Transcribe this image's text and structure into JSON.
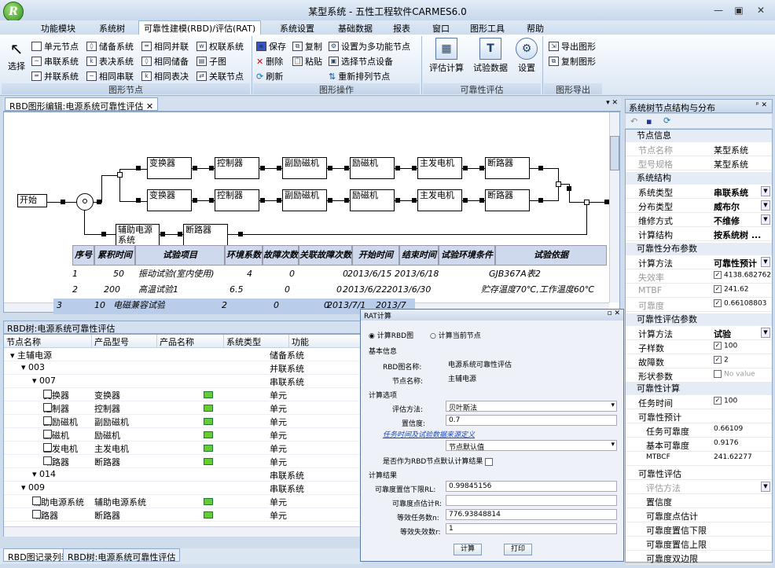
{
  "app": {
    "title": "某型系统 - 五性工程软件CARMES6.0",
    "logo": "R",
    "win_buttons": [
      "—",
      "▣",
      "✕"
    ]
  },
  "menus": [
    "功能模块",
    "系统树",
    "可靠性建模(RBD)/评估(RAT)",
    "系统设置",
    "基础数据",
    "报表",
    "窗口",
    "图形工具",
    "帮助"
  ],
  "ribbon": {
    "select_label": "选择",
    "node_group": {
      "items": [
        "单元节点",
        "串联系统",
        "并联系统",
        "储备系统",
        "表决系统",
        "相同串联",
        "相同并联",
        "相同储备",
        "相同表决",
        "权联系统",
        "子图",
        "关联节点"
      ],
      "label": "图形节点"
    },
    "op_group": {
      "items": [
        "保存",
        "删除",
        "刷新",
        "复制",
        "粘贴",
        "设置为多功能节点",
        "选择节点设备",
        "重新排列节点"
      ],
      "label": "图形操作"
    },
    "eval_group": {
      "items": [
        "评估计算",
        "试验数据",
        "设置"
      ],
      "label": "可靠性评估"
    },
    "export_group": {
      "items": [
        "导出图形",
        "复制图形"
      ],
      "label": "图形导出"
    }
  },
  "doc_tab": "RBD图形编辑:电源系统可靠性评估",
  "rbd": {
    "start": "开始",
    "row1": [
      "变换器",
      "控制器",
      "副励磁机",
      "励磁机",
      "主发电机",
      "断路器"
    ],
    "row2": [
      "变换器",
      "控制器",
      "副励磁机",
      "励磁机",
      "主发电机",
      "断路器"
    ],
    "aux": [
      "辅助电源系统",
      "断路器"
    ]
  },
  "test_table": {
    "headers": [
      "序号",
      "累积时间",
      "试验项目",
      "环境系数",
      "故障次数",
      "关联故障次数",
      "开始时间",
      "结束时间",
      "试验环境条件",
      "试验依据"
    ],
    "rows": [
      [
        "1",
        "50",
        "振动试验(室内使用)",
        "4",
        "0",
        "0",
        "2013/6/15",
        "2013/6/18",
        "",
        "GJB367A表2"
      ],
      [
        "2",
        "200",
        "高温试验1",
        "6.5",
        "0",
        "0",
        "2013/6/22",
        "2013/6/30",
        "",
        "贮存温度70℃,工作温度60℃"
      ],
      [
        "3",
        "10",
        "电磁兼容试验",
        "2",
        "0",
        "0",
        "2013/7/1",
        "2013/7",
        "",
        ""
      ]
    ]
  },
  "tree_panel": {
    "title": "RBD树:电源系统可靠性评估",
    "headers": [
      "节点名称",
      "产品型号",
      "产品名称",
      "系统类型",
      "功能"
    ],
    "rows": [
      {
        "name": "主辅电源",
        "model": "",
        "type": "储备系统",
        "level": 0
      },
      {
        "name": "003",
        "model": "",
        "type": "并联系统",
        "level": 1
      },
      {
        "name": "007",
        "model": "",
        "type": "串联系统",
        "level": 2
      },
      {
        "name": "变换器",
        "model": "变换器",
        "type": "单元",
        "level": 3
      },
      {
        "name": "控制器",
        "model": "控制器",
        "type": "单元",
        "level": 3
      },
      {
        "name": "副励磁机",
        "model": "副励磁机",
        "type": "单元",
        "level": 3
      },
      {
        "name": "励磁机",
        "model": "励磁机",
        "type": "单元",
        "level": 3
      },
      {
        "name": "主发电机",
        "model": "主发电机",
        "type": "单元",
        "level": 3
      },
      {
        "name": "断路器",
        "model": "断路器",
        "type": "单元",
        "level": 3
      },
      {
        "name": "014",
        "model": "",
        "type": "串联系统",
        "level": 2
      },
      {
        "name": "009",
        "model": "",
        "type": "串联系统",
        "level": 1
      },
      {
        "name": "辅助电源系统",
        "model": "辅助电源系统",
        "type": "单元",
        "level": 2
      },
      {
        "name": "断路器",
        "model": "断路器",
        "type": "单元",
        "level": 2
      }
    ]
  },
  "bottom_tabs": [
    "RBD图记录列表",
    "RBD树:电源系统可靠性评估"
  ],
  "right_panel": {
    "title": "系统树节点结构与分布",
    "node_info": "节点信息",
    "node_name_k": "节点名称",
    "node_name_v": "某型系统",
    "model_k": "型号规格",
    "model_v": "某型系统",
    "struct": "系统结构",
    "sys_type_k": "系统类型",
    "sys_type_v": "串联系统",
    "dist_k": "分布类型",
    "dist_v": "威布尔",
    "maint_k": "维修方式",
    "maint_v": "不维修",
    "calc_struct_k": "计算结构",
    "calc_struct_v": "按系统树 ...",
    "dist_param": "可靠性分布参数",
    "calc_method_k": "计算方法",
    "calc_method_v": "可靠性预计",
    "fail_k": "失效率",
    "fail_v": "4138.682762",
    "mtbf_k": "MTBF",
    "mtbf_v": "241.62",
    "rel_k": "可靠度",
    "rel_v": "0.66108803",
    "eval_param": "可靠性评估参数",
    "em_k": "计算方法",
    "em_v": "试验",
    "sample_k": "子样数",
    "sample_v": "100",
    "fails_k": "故障数",
    "fails_v": "2",
    "shape_k": "形状参数",
    "shape_v": "No value",
    "calc": "可靠性计算",
    "mt_k": "任务时间",
    "mt_v": "100",
    "pred": "可靠性预计",
    "tr_k": "任务可靠度",
    "tr_v": "0.66109",
    "br_k": "基本可靠度",
    "br_v": "0.9176",
    "mtbcf_k": "MTBCF",
    "mtbcf_v": "241.62277",
    "evalh": "可靠性评估",
    "em2_k": "评估方法",
    "conf_k": "置信度",
    "pe_k": "可靠度点估计",
    "lo_k": "可靠度置信下限",
    "up_k": "可靠度置信上限",
    "two_k": "可靠度双边限"
  },
  "dialog": {
    "title": "RAT计算",
    "opt1": "计算RBD图",
    "opt2": "计算当前节点",
    "basic": "基本信息",
    "rbd_name_k": "RBD图名称:",
    "rbd_name_v": "电源系统可靠性评估",
    "node_k": "节点名称:",
    "node_v": "主辅电源",
    "calc_opt": "计算选项",
    "method_k": "评估方法:",
    "method_v": "贝叶斯法",
    "conf_k": "置信度:",
    "conf_v": "0.7",
    "link": "任务时间及试验数据来源定义",
    "default_v": "节点默认值",
    "is_default": "是否作为RBD节点默认计算结果",
    "result": "计算结果",
    "lower_k": "可靠度置信下限RL:",
    "lower_v": "0.99845156",
    "pe_k": "可靠度点估计R:",
    "pe_v": "",
    "eq_tasks_k": "等效任务数n:",
    "eq_tasks_v": "776.93848814",
    "eq_fails_k": "等效失效数r:",
    "eq_fails_v": "1",
    "calc_btn": "计算",
    "print_btn": "打印"
  }
}
